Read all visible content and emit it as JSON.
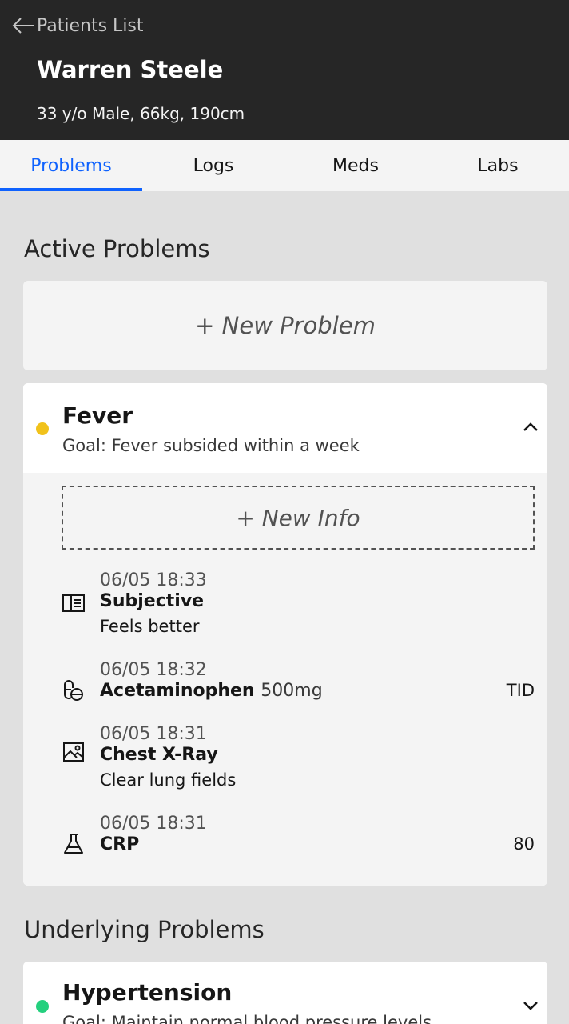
{
  "header": {
    "back_label": "Patients List",
    "patient_name": "Warren Steele",
    "patient_info": "33 y/o Male, 66kg, 190cm"
  },
  "tabs": [
    {
      "label": "Problems",
      "active": true
    },
    {
      "label": "Logs",
      "active": false
    },
    {
      "label": "Meds",
      "active": false
    },
    {
      "label": "Labs",
      "active": false
    }
  ],
  "active_section": {
    "title": "Active Problems",
    "new_problem_label": "+ New Problem"
  },
  "fever": {
    "name": "Fever",
    "goal": "Goal: Fever subsided within a week",
    "status_color": "#f1c21b",
    "expanded": true,
    "new_info_label": "+ New Info",
    "entries": [
      {
        "icon": "notes-icon",
        "time": "06/05 18:33",
        "title": "Subjective",
        "detail": "Feels better",
        "right": ""
      },
      {
        "icon": "pill-icon",
        "time": "06/05 18:32",
        "title": "Acetaminophen",
        "dose": "500mg",
        "detail": "",
        "right": "TID"
      },
      {
        "icon": "image-icon",
        "time": "06/05 18:31",
        "title": "Chest X-Ray",
        "detail": "Clear lung fields",
        "right": ""
      },
      {
        "icon": "flask-icon",
        "time": "06/05 18:31",
        "title": "CRP",
        "detail": "",
        "right": "80"
      }
    ]
  },
  "underlying_section": {
    "title": "Underlying Problems"
  },
  "hypertension": {
    "name": "Hypertension",
    "goal": "Goal: Maintain normal blood pressure levels",
    "status_color": "#24d07e",
    "expanded": false
  },
  "colors": {
    "header_bg": "#262626",
    "accent": "#0f62fe",
    "page_bg": "#e0e0e0"
  }
}
